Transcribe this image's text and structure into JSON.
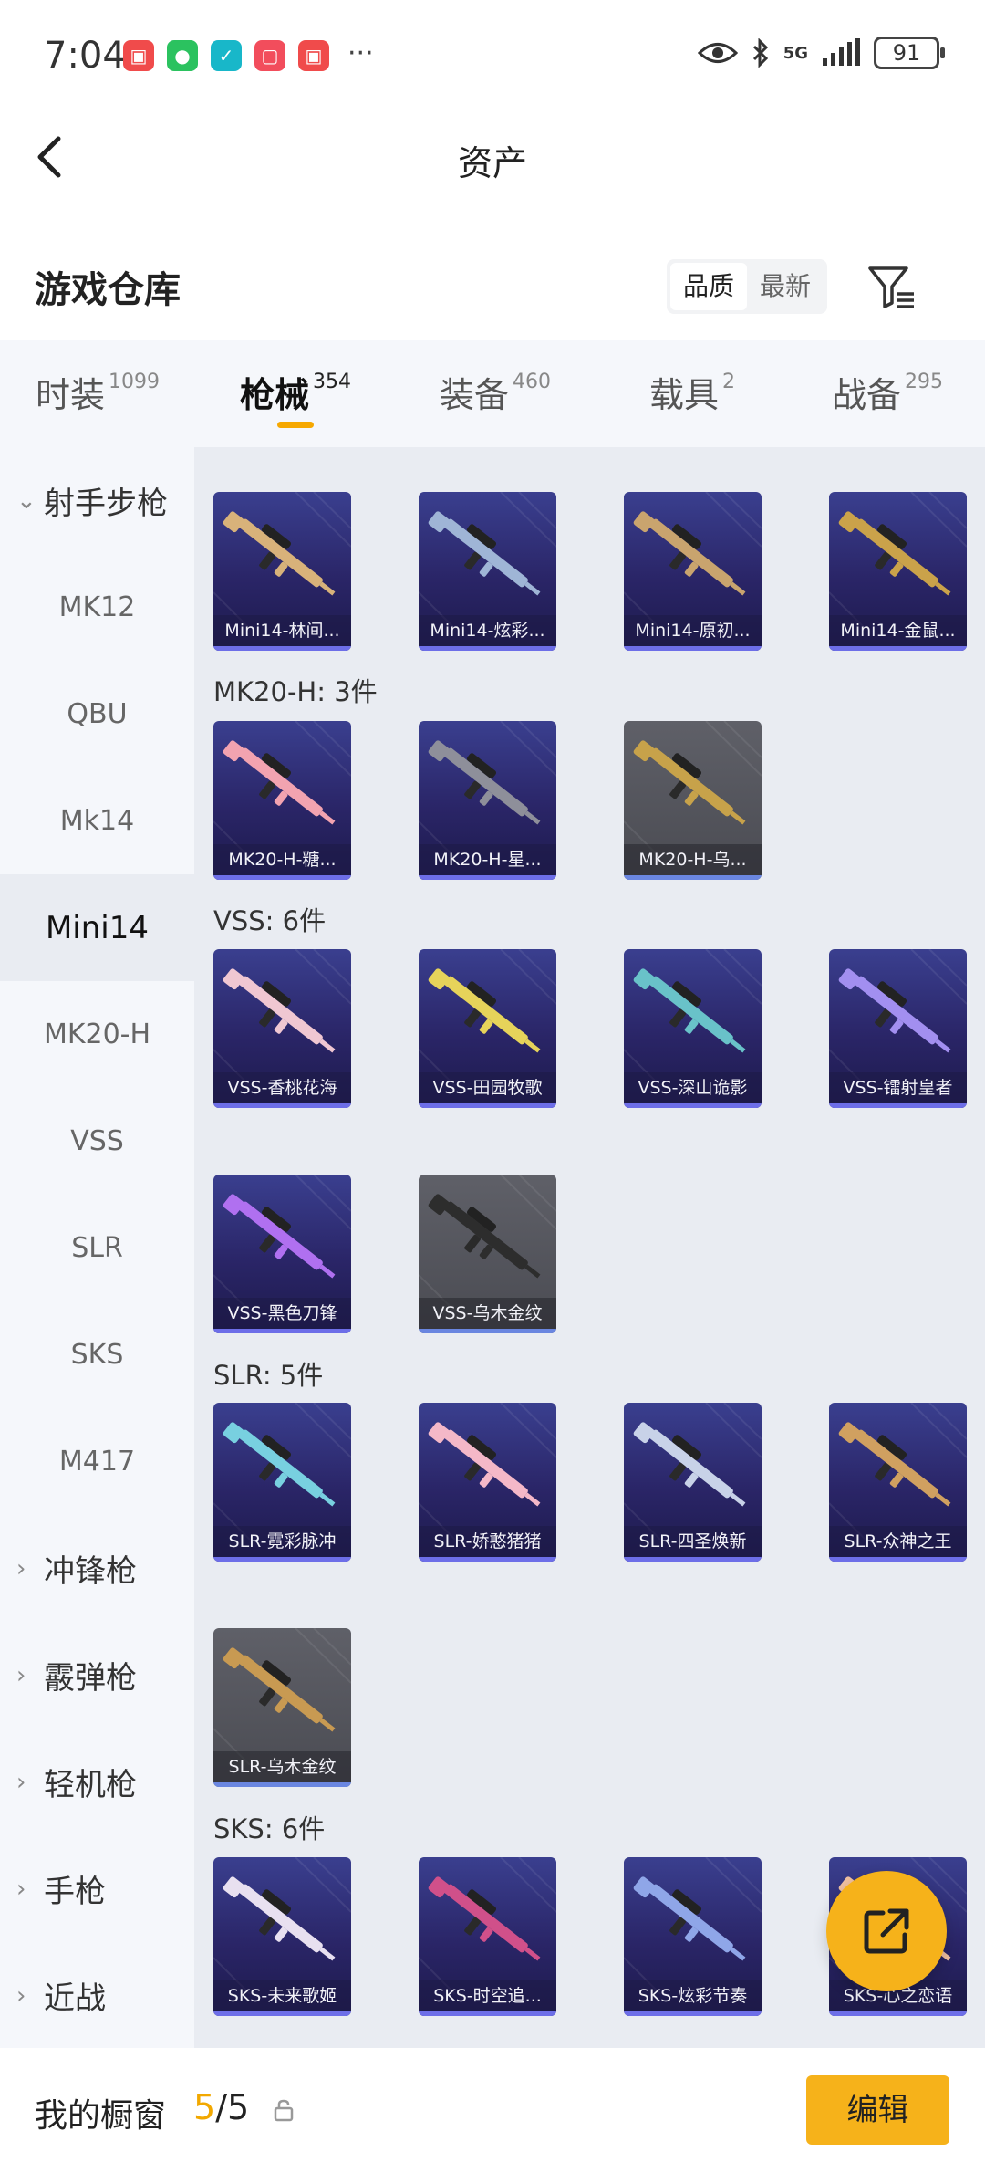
{
  "status": {
    "time": "7:04",
    "battery": "91",
    "network": "5G"
  },
  "nav": {
    "title": "资产"
  },
  "warehouse": {
    "title": "游戏仓库",
    "sort_quality": "品质",
    "sort_newest": "最新"
  },
  "tabs": [
    {
      "label": "时装",
      "count": "1099"
    },
    {
      "label": "枪械",
      "count": "354"
    },
    {
      "label": "装备",
      "count": "460"
    },
    {
      "label": "载具",
      "count": "2"
    },
    {
      "label": "战备",
      "count": "295"
    }
  ],
  "sidebar": [
    {
      "label": "射手步枪",
      "type": "group",
      "expanded": true
    },
    {
      "label": "MK12"
    },
    {
      "label": "QBU"
    },
    {
      "label": "Mk14"
    },
    {
      "label": "Mini14",
      "active": true
    },
    {
      "label": "MK20-H"
    },
    {
      "label": "VSS"
    },
    {
      "label": "SLR"
    },
    {
      "label": "SKS"
    },
    {
      "label": "M417"
    },
    {
      "label": "冲锋枪",
      "type": "group"
    },
    {
      "label": "霰弹枪",
      "type": "group"
    },
    {
      "label": "轻机枪",
      "type": "group"
    },
    {
      "label": "手枪",
      "type": "group"
    },
    {
      "label": "近战",
      "type": "group"
    }
  ],
  "groups": {
    "mk20h": "MK20-H: 3件",
    "vss": "VSS: 6件",
    "slr": "SLR: 5件",
    "sks": "SKS: 6件"
  },
  "items": {
    "mini14": [
      "Mini14-林间...",
      "Mini14-炫彩...",
      "Mini14-原初...",
      "Mini14-金鼠..."
    ],
    "mk20h": [
      "MK20-H-糖...",
      "MK20-H-星...",
      "MK20-H-乌..."
    ],
    "vss": [
      "VSS-香桃花海",
      "VSS-田园牧歌",
      "VSS-深山诡影",
      "VSS-镭射皇者",
      "VSS-黑色刀锋",
      "VSS-乌木金纹"
    ],
    "slr": [
      "SLR-霓彩脉冲",
      "SLR-娇憨猪猪",
      "SLR-四圣焕新",
      "SLR-众神之王",
      "SLR-乌木金纹"
    ],
    "sks": [
      "SKS-未来歌姬",
      "SKS-时空追...",
      "SKS-炫彩节奏",
      "SKS-心之恋语"
    ]
  },
  "showcase": {
    "label": "我的橱窗",
    "current": "5",
    "total": "/5",
    "edit_label": "编辑"
  },
  "colors": {
    "accent": "#f6b21a",
    "card_purple": "#2a2567",
    "card_gray": "#4a4b52"
  }
}
